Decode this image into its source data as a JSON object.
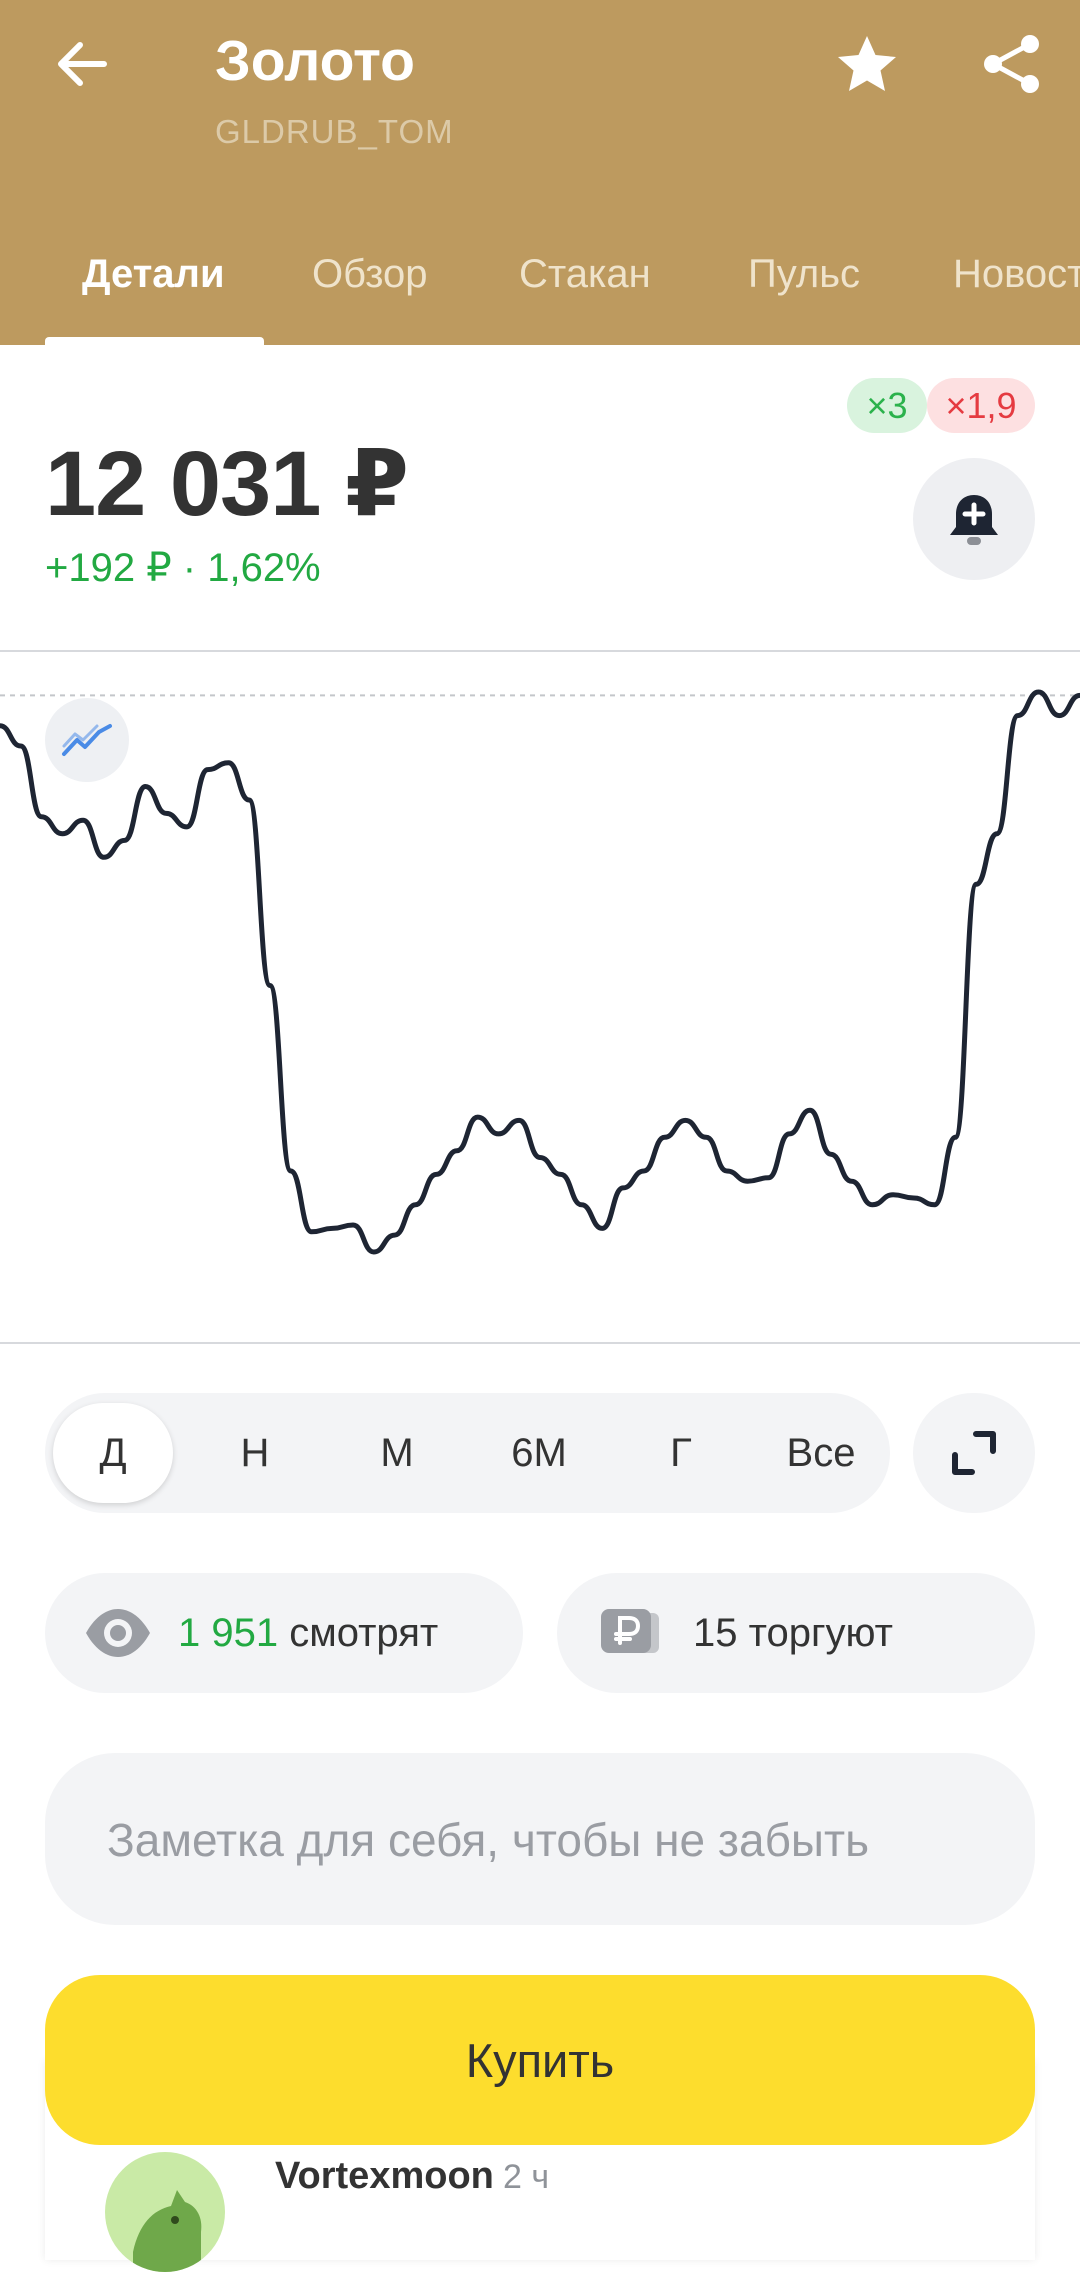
{
  "header": {
    "title": "Золото",
    "ticker": "GLDRUB_TOM",
    "tabs": [
      "Детали",
      "Обзор",
      "Стакан",
      "Пульс",
      "Новости"
    ],
    "active_tab": "Детали",
    "back_icon": "arrow-left-icon",
    "favorite_icon": "star-icon",
    "share_icon": "share-icon"
  },
  "leverage": {
    "long": "×3",
    "short": "×1,9"
  },
  "price": {
    "value": "12 031 ₽",
    "change": "+192 ₽ · 1,62%"
  },
  "chart_data": {
    "type": "line",
    "period": "Д",
    "series": [
      {
        "values": [
          12022,
          12016,
          11995,
          11990,
          11994,
          11983,
          11988,
          12004,
          11996,
          11992,
          12009,
          12011,
          12000,
          11945,
          11890,
          11872,
          11873,
          11874,
          11866,
          11871,
          11880,
          11889,
          11896,
          11906,
          11901,
          11905,
          11894,
          11889,
          11880,
          11873,
          11885,
          11890,
          11900,
          11905,
          11900,
          11890,
          11887,
          11888,
          11901,
          11908,
          11895,
          11887,
          11880,
          11883,
          11882,
          11880,
          11900,
          11975,
          11990,
          12025,
          12032,
          12025,
          12031
        ]
      }
    ],
    "reference_line": 12031,
    "colors": {
      "line": "#1e2533",
      "reference": "#c4c6ca"
    }
  },
  "periods": [
    "Д",
    "Н",
    "М",
    "6М",
    "Г",
    "Все"
  ],
  "active_period": "Д",
  "stats": {
    "watching_count": "1 951",
    "watching_label": "смотрят",
    "trading_label": "15 торгуют"
  },
  "note": {
    "placeholder": "Заметка для себя, чтобы не забыть"
  },
  "buy_label": "Купить",
  "post": {
    "author": "Vortexmoon",
    "time": "2 ч"
  },
  "colors": {
    "brand": "#bd9a5f",
    "positive": "#22a942",
    "negative": "#e53b41",
    "buy": "#fddd2d"
  }
}
